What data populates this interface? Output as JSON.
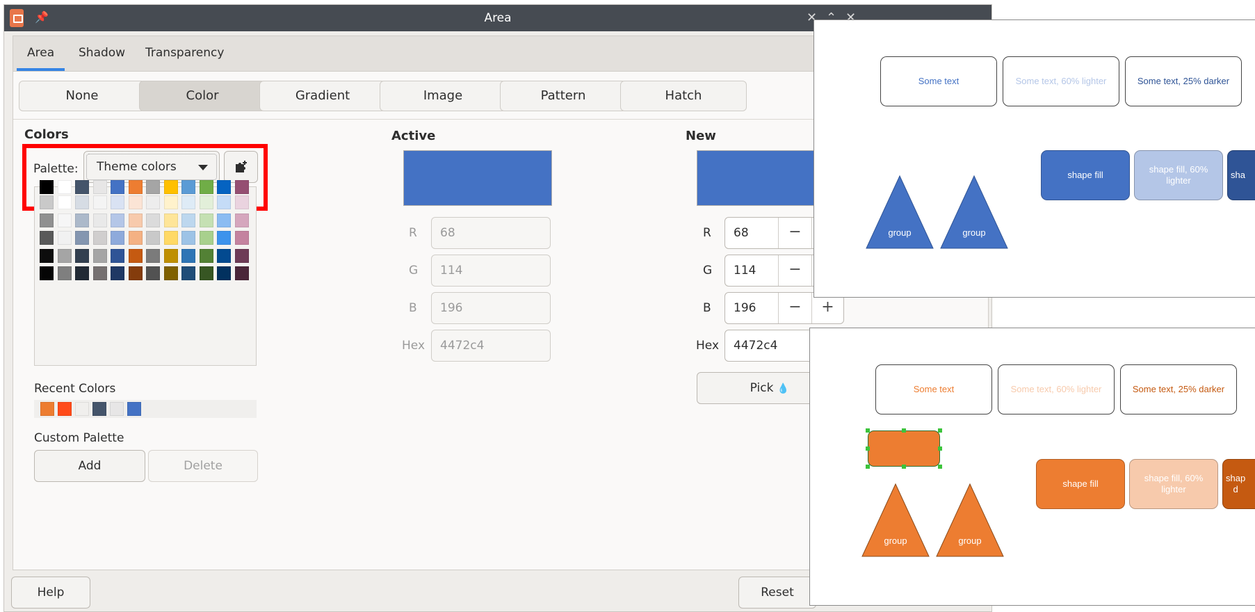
{
  "window": {
    "title": "Area"
  },
  "tabs": [
    {
      "label": "Area",
      "active": true
    },
    {
      "label": "Shadow",
      "active": false
    },
    {
      "label": "Transparency",
      "active": false
    }
  ],
  "fill_types": [
    {
      "label": "None",
      "active": false
    },
    {
      "label": "Color",
      "active": true
    },
    {
      "label": "Gradient",
      "active": false
    },
    {
      "label": "Image",
      "active": false
    },
    {
      "label": "Pattern",
      "active": false
    },
    {
      "label": "Hatch",
      "active": false
    }
  ],
  "colors": {
    "heading": "Colors",
    "palette_label": "Palette:",
    "palette_value": "Theme colors",
    "swatch_rows": [
      [
        "#000000",
        "#ffffff",
        "#44546a",
        "#e7e6e6",
        "#4472c4",
        "#ed7d31",
        "#a5a5a5",
        "#ffc000",
        "#5b9bd5",
        "#70ad47",
        "#0563c1",
        "#954f72"
      ],
      [
        "#c9c9c9",
        "#ffffff",
        "#d6dce4",
        "#f4f4f4",
        "#d9e2f3",
        "#fbe4d5",
        "#ededed",
        "#fff2cc",
        "#deebf6",
        "#e2efd9",
        "#c5dcf7",
        "#ead3df"
      ],
      [
        "#909090",
        "#f6f6f6",
        "#acb9ca",
        "#e9e9e9",
        "#b4c6e7",
        "#f7caac",
        "#dbdbdb",
        "#fee599",
        "#bdd7ee",
        "#c5e0b3",
        "#8bbcf2",
        "#d5a6bd"
      ],
      [
        "#595959",
        "#f1f1f1",
        "#8496b0",
        "#d0cece",
        "#8eaadb",
        "#f4b183",
        "#c9c9c9",
        "#ffd965",
        "#9dc3e6",
        "#a8d08d",
        "#3d93ec",
        "#c4839f"
      ],
      [
        "#0d0d0d",
        "#a5a5a5",
        "#323f4f",
        "#a5a5a5",
        "#2f5496",
        "#c55a11",
        "#7b7b7b",
        "#bf8f00",
        "#2e75b5",
        "#538135",
        "#034a90",
        "#6e3b56"
      ],
      [
        "#050505",
        "#7f7f7f",
        "#222a35",
        "#757070",
        "#1f3864",
        "#843c0c",
        "#525252",
        "#7f6000",
        "#1f4d78",
        "#375623",
        "#02315f",
        "#4b2639"
      ]
    ],
    "recent_label": "Recent Colors",
    "recent": [
      "#ed7d31",
      "#ff4b1a",
      "#f0efed",
      "#44546a",
      "#e7e6e6",
      "#4472c4"
    ],
    "custom_label": "Custom Palette",
    "add_label": "Add",
    "delete_label": "Delete"
  },
  "active": {
    "heading": "Active",
    "color": "#4472c4",
    "r_label": "R",
    "r": "68",
    "g_label": "G",
    "g": "114",
    "b_label": "B",
    "b": "196",
    "hex_label": "Hex",
    "hex": "4472c4"
  },
  "new": {
    "heading": "New",
    "color": "#4472c4",
    "r_label": "R",
    "r": "68",
    "g_label": "G",
    "g": "114",
    "b_label": "B",
    "b": "196",
    "hex_label": "Hex",
    "hex": "4472c4",
    "minus": "−",
    "plus": "+",
    "pick_label": "Pick"
  },
  "footer": {
    "help_label": "Help",
    "reset_label": "Reset"
  },
  "slide_blue": {
    "text_plain": "Some text",
    "text_lighter": "Some text, 60% lighter",
    "text_darker": "Some text, 25% darker",
    "fill_plain": "shape fill",
    "fill_lighter": "shape fill, 60% lighter",
    "fill_darker": "sha",
    "group1": "group",
    "group2": "group",
    "accent": "#4472c4",
    "lighter": "#b4c6e7",
    "darker": "#2f5496"
  },
  "slide_orange": {
    "text_plain": "Some text",
    "text_lighter": "Some text, 60% lighter",
    "text_darker": "Some text, 25% darker",
    "fill_plain": "shape fill",
    "fill_lighter": "shape fill, 60% lighter",
    "fill_darker": "shap\nd",
    "group1": "group",
    "group2": "group",
    "accent": "#ed7d31",
    "lighter": "#f7caac",
    "darker": "#c55a11"
  }
}
